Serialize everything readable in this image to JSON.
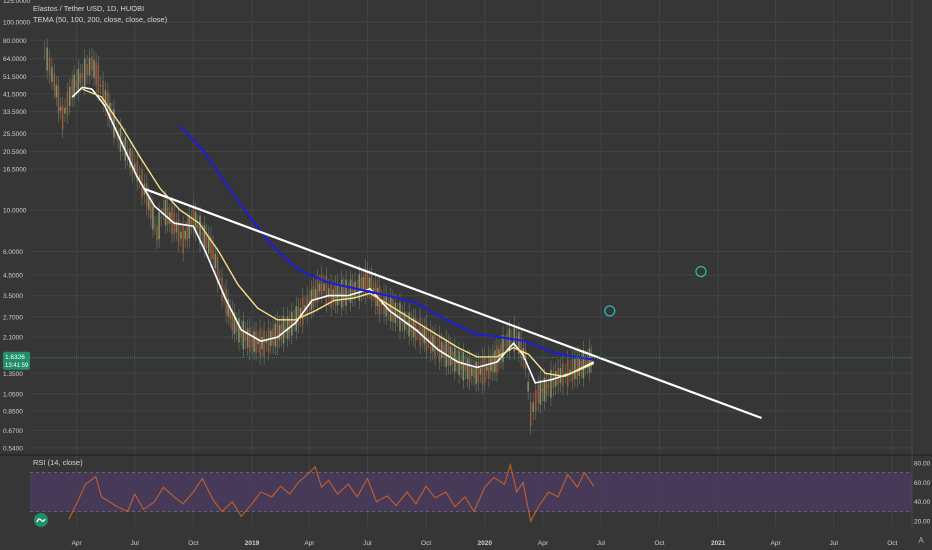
{
  "main_legend": {
    "title": "Elastos / Tether USD, 1D, HUOBI",
    "indicator": "TEMA (50, 100, 200, close, close, close)"
  },
  "rsi_legend": "RSI (14, close)",
  "colors": {
    "background": "#363636",
    "grid": "#444444",
    "candles": "#6f7a62",
    "tema_fast": "#ffffff",
    "tema_mid": "#f7e08a",
    "tema_slow": "#1f1fcc",
    "trendline": "#ffffff",
    "rsi_line": "#c0602a",
    "rsi_band": "#4a3a5e",
    "price_tag": "#1f8f6a",
    "circle_marker": "#2cc0b0"
  },
  "chart_data": [
    {
      "type": "line",
      "name": "price",
      "scale": "log",
      "ylim": [
        0.54,
        125
      ],
      "y_ticks": [
        {
          "value": 100,
          "label": "100.0000"
        },
        {
          "value": 80,
          "label": "80.0000"
        },
        {
          "value": 64,
          "label": "64.0000"
        },
        {
          "value": 51.5,
          "label": "51.5000"
        },
        {
          "value": 41.5,
          "label": "41.5000"
        },
        {
          "value": 33.5,
          "label": "33.5000"
        },
        {
          "value": 25.5,
          "label": "25.5000"
        },
        {
          "value": 20.5,
          "label": "20.5000"
        },
        {
          "value": 16.5,
          "label": "16.5000"
        },
        {
          "value": 10,
          "label": "10.0000"
        },
        {
          "value": 6,
          "label": "6.0000"
        },
        {
          "value": 4.5,
          "label": "4.5000"
        },
        {
          "value": 3.5,
          "label": "3.5000"
        },
        {
          "value": 2.7,
          "label": "2.7000"
        },
        {
          "value": 2.1,
          "label": "2.1000"
        },
        {
          "value": 1.35,
          "label": "1.3500"
        },
        {
          "value": 1.05,
          "label": "1.0500"
        },
        {
          "value": 0.85,
          "label": "0.8500"
        },
        {
          "value": 0.67,
          "label": "0.6700"
        },
        {
          "value": 0.54,
          "label": "0.5400"
        }
      ],
      "top_tick_partial": "125.0000",
      "x_ticks": [
        {
          "date": "2018-04-01",
          "label": "Apr"
        },
        {
          "date": "2018-07-01",
          "label": "Jul"
        },
        {
          "date": "2018-10-01",
          "label": "Oct"
        },
        {
          "date": "2019-01-01",
          "label": "2019"
        },
        {
          "date": "2019-04-01",
          "label": "Apr"
        },
        {
          "date": "2019-07-01",
          "label": "Jul"
        },
        {
          "date": "2019-10-01",
          "label": "Oct"
        },
        {
          "date": "2020-01-01",
          "label": "2020"
        },
        {
          "date": "2020-04-01",
          "label": "Apr"
        },
        {
          "date": "2020-07-01",
          "label": "Jul"
        },
        {
          "date": "2020-10-01",
          "label": "Oct"
        },
        {
          "date": "2021-01-01",
          "label": "2021"
        },
        {
          "date": "2021-04-01",
          "label": "Apr"
        },
        {
          "date": "2021-07-01",
          "label": "Jul"
        },
        {
          "date": "2021-10-01",
          "label": "Oct"
        }
      ],
      "last_price": {
        "label": "1.6326",
        "countdown": "13:41:59",
        "value": 1.6326
      },
      "series": [
        {
          "name": "close",
          "points": [
            [
              "2018-02-10",
              70
            ],
            [
              "2018-02-25",
              48
            ],
            [
              "2018-03-10",
              31
            ],
            [
              "2018-03-25",
              44
            ],
            [
              "2018-04-10",
              52
            ],
            [
              "2018-04-25",
              60
            ],
            [
              "2018-05-05",
              50
            ],
            [
              "2018-05-20",
              36
            ],
            [
              "2018-06-05",
              25
            ],
            [
              "2018-06-20",
              20
            ],
            [
              "2018-07-05",
              16
            ],
            [
              "2018-07-20",
              12
            ],
            [
              "2018-08-05",
              7.5
            ],
            [
              "2018-08-15",
              10
            ],
            [
              "2018-09-01",
              8.5
            ],
            [
              "2018-09-15",
              7
            ],
            [
              "2018-10-01",
              9
            ],
            [
              "2018-10-15",
              7.5
            ],
            [
              "2018-11-01",
              6
            ],
            [
              "2018-11-15",
              3.8
            ],
            [
              "2018-12-01",
              2.6
            ],
            [
              "2018-12-15",
              2.2
            ],
            [
              "2019-01-01",
              2.0
            ],
            [
              "2019-01-20",
              1.95
            ],
            [
              "2019-02-10",
              2.2
            ],
            [
              "2019-03-01",
              2.4
            ],
            [
              "2019-04-01",
              3.2
            ],
            [
              "2019-04-20",
              4.0
            ],
            [
              "2019-05-05",
              3.5
            ],
            [
              "2019-05-25",
              3.6
            ],
            [
              "2019-06-15",
              3.8
            ],
            [
              "2019-07-01",
              4.2
            ],
            [
              "2019-07-20",
              3.3
            ],
            [
              "2019-08-10",
              2.9
            ],
            [
              "2019-09-01",
              2.5
            ],
            [
              "2019-09-25",
              2.2
            ],
            [
              "2019-10-15",
              1.9
            ],
            [
              "2019-11-05",
              1.7
            ],
            [
              "2019-11-25",
              1.5
            ],
            [
              "2019-12-15",
              1.35
            ],
            [
              "2020-01-01",
              1.4
            ],
            [
              "2020-01-20",
              1.6
            ],
            [
              "2020-02-05",
              2.0
            ],
            [
              "2020-02-20",
              2.1
            ],
            [
              "2020-03-05",
              1.6
            ],
            [
              "2020-03-13",
              0.82
            ],
            [
              "2020-03-25",
              1.05
            ],
            [
              "2020-04-10",
              1.15
            ],
            [
              "2020-04-25",
              1.3
            ],
            [
              "2020-05-10",
              1.35
            ],
            [
              "2020-05-25",
              1.45
            ],
            [
              "2020-06-10",
              1.55
            ],
            [
              "2020-06-20",
              1.63
            ]
          ]
        },
        {
          "name": "TEMA 50",
          "points": [
            [
              "2018-03-25",
              40
            ],
            [
              "2018-04-10",
              45
            ],
            [
              "2018-04-25",
              44
            ],
            [
              "2018-05-15",
              36
            ],
            [
              "2018-06-10",
              23
            ],
            [
              "2018-07-05",
              15
            ],
            [
              "2018-08-01",
              10.5
            ],
            [
              "2018-09-01",
              8.5
            ],
            [
              "2018-10-01",
              8.2
            ],
            [
              "2018-10-20",
              6
            ],
            [
              "2018-11-20",
              3.4
            ],
            [
              "2018-12-15",
              2.3
            ],
            [
              "2019-01-15",
              2.0
            ],
            [
              "2019-02-10",
              2.1
            ],
            [
              "2019-03-10",
              2.5
            ],
            [
              "2019-04-05",
              3.3
            ],
            [
              "2019-05-01",
              3.5
            ],
            [
              "2019-06-01",
              3.5
            ],
            [
              "2019-07-05",
              3.8
            ],
            [
              "2019-08-05",
              2.9
            ],
            [
              "2019-09-15",
              2.3
            ],
            [
              "2019-10-20",
              1.8
            ],
            [
              "2019-11-20",
              1.55
            ],
            [
              "2019-12-20",
              1.45
            ],
            [
              "2020-01-20",
              1.55
            ],
            [
              "2020-02-15",
              1.95
            ],
            [
              "2020-03-01",
              1.7
            ],
            [
              "2020-03-20",
              1.2
            ],
            [
              "2020-04-15",
              1.25
            ],
            [
              "2020-05-15",
              1.35
            ],
            [
              "2020-06-20",
              1.55
            ]
          ]
        },
        {
          "name": "TEMA 100",
          "points": [
            [
              "2018-04-10",
              44
            ],
            [
              "2018-05-10",
              40
            ],
            [
              "2018-06-10",
              28
            ],
            [
              "2018-07-10",
              19
            ],
            [
              "2018-08-10",
              13
            ],
            [
              "2018-09-10",
              10
            ],
            [
              "2018-10-10",
              8.5
            ],
            [
              "2018-11-10",
              6
            ],
            [
              "2018-12-10",
              4
            ],
            [
              "2019-01-10",
              3.0
            ],
            [
              "2019-02-10",
              2.6
            ],
            [
              "2019-03-10",
              2.6
            ],
            [
              "2019-04-10",
              2.9
            ],
            [
              "2019-05-10",
              3.3
            ],
            [
              "2019-06-10",
              3.4
            ],
            [
              "2019-07-05",
              3.6
            ],
            [
              "2019-08-05",
              3.1
            ],
            [
              "2019-09-10",
              2.6
            ],
            [
              "2019-10-15",
              2.2
            ],
            [
              "2019-11-20",
              1.85
            ],
            [
              "2019-12-20",
              1.65
            ],
            [
              "2020-01-20",
              1.65
            ],
            [
              "2020-02-15",
              1.85
            ],
            [
              "2020-03-10",
              1.7
            ],
            [
              "2020-04-05",
              1.35
            ],
            [
              "2020-05-05",
              1.3
            ],
            [
              "2020-06-20",
              1.52
            ]
          ]
        },
        {
          "name": "TEMA 200",
          "points": [
            [
              "2018-09-10",
              28
            ],
            [
              "2018-10-15",
              21
            ],
            [
              "2018-11-20",
              14
            ],
            [
              "2018-12-25",
              9.5
            ],
            [
              "2019-02-01",
              6.5
            ],
            [
              "2019-03-15",
              4.8
            ],
            [
              "2019-05-01",
              4.1
            ],
            [
              "2019-06-15",
              3.8
            ],
            [
              "2019-08-01",
              3.5
            ],
            [
              "2019-09-15",
              3.2
            ],
            [
              "2019-11-01",
              2.6
            ],
            [
              "2019-12-15",
              2.2
            ],
            [
              "2020-01-25",
              2.1
            ],
            [
              "2020-03-05",
              2.0
            ],
            [
              "2020-04-15",
              1.75
            ],
            [
              "2020-05-20",
              1.65
            ],
            [
              "2020-06-20",
              1.6
            ]
          ]
        }
      ],
      "trendline": {
        "from": [
          "2018-07-15",
          13
        ],
        "to": [
          "2021-03-10",
          0.78
        ]
      },
      "circle_markers": [
        [
          "2020-07-15",
          2.9
        ],
        [
          "2020-12-05",
          4.7
        ]
      ]
    },
    {
      "type": "line",
      "name": "RSI (14, close)",
      "ylim": [
        14,
        85
      ],
      "y_ticks": [
        {
          "value": 80,
          "label": "80.00"
        },
        {
          "value": 60,
          "label": "60.00"
        },
        {
          "value": 40,
          "label": "40.00"
        },
        {
          "value": 20,
          "label": "20.00"
        }
      ],
      "band": [
        30,
        70
      ],
      "series": [
        {
          "name": "RSI",
          "points": [
            [
              "2018-03-20",
              22
            ],
            [
              "2018-04-01",
              38
            ],
            [
              "2018-04-15",
              58
            ],
            [
              "2018-05-01",
              66
            ],
            [
              "2018-05-10",
              45
            ],
            [
              "2018-06-01",
              36
            ],
            [
              "2018-06-20",
              30
            ],
            [
              "2018-07-01",
              48
            ],
            [
              "2018-07-15",
              32
            ],
            [
              "2018-08-01",
              40
            ],
            [
              "2018-08-15",
              55
            ],
            [
              "2018-09-01",
              45
            ],
            [
              "2018-09-15",
              38
            ],
            [
              "2018-10-01",
              50
            ],
            [
              "2018-10-15",
              64
            ],
            [
              "2018-11-01",
              42
            ],
            [
              "2018-11-15",
              30
            ],
            [
              "2018-12-01",
              40
            ],
            [
              "2018-12-15",
              25
            ],
            [
              "2019-01-01",
              38
            ],
            [
              "2019-01-15",
              50
            ],
            [
              "2019-02-01",
              45
            ],
            [
              "2019-02-15",
              56
            ],
            [
              "2019-03-01",
              48
            ],
            [
              "2019-03-15",
              60
            ],
            [
              "2019-04-01",
              70
            ],
            [
              "2019-04-10",
              76
            ],
            [
              "2019-04-20",
              55
            ],
            [
              "2019-05-01",
              62
            ],
            [
              "2019-05-15",
              48
            ],
            [
              "2019-06-01",
              58
            ],
            [
              "2019-06-15",
              45
            ],
            [
              "2019-07-01",
              64
            ],
            [
              "2019-07-15",
              40
            ],
            [
              "2019-08-01",
              46
            ],
            [
              "2019-08-15",
              36
            ],
            [
              "2019-09-01",
              50
            ],
            [
              "2019-09-15",
              38
            ],
            [
              "2019-10-01",
              56
            ],
            [
              "2019-10-15",
              44
            ],
            [
              "2019-11-01",
              50
            ],
            [
              "2019-11-15",
              35
            ],
            [
              "2019-12-01",
              45
            ],
            [
              "2019-12-15",
              30
            ],
            [
              "2020-01-01",
              55
            ],
            [
              "2020-01-15",
              65
            ],
            [
              "2020-02-01",
              58
            ],
            [
              "2020-02-10",
              78
            ],
            [
              "2020-02-20",
              50
            ],
            [
              "2020-03-01",
              60
            ],
            [
              "2020-03-13",
              20
            ],
            [
              "2020-03-25",
              35
            ],
            [
              "2020-04-10",
              50
            ],
            [
              "2020-04-25",
              45
            ],
            [
              "2020-05-10",
              68
            ],
            [
              "2020-05-25",
              55
            ],
            [
              "2020-06-05",
              70
            ],
            [
              "2020-06-20",
              56
            ]
          ]
        }
      ]
    }
  ],
  "icons": {
    "rsi_badge": "tradingview-logo-icon",
    "price_axis_settings": "a-letter-icon"
  },
  "badge_text": "A"
}
